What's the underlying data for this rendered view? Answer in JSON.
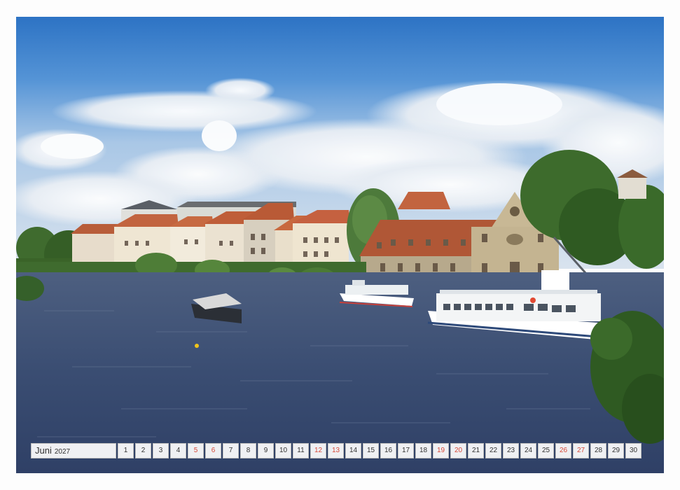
{
  "calendar": {
    "month": "Juni",
    "year": "2027",
    "days": [
      {
        "n": "1",
        "w": false
      },
      {
        "n": "2",
        "w": false
      },
      {
        "n": "3",
        "w": false
      },
      {
        "n": "4",
        "w": false
      },
      {
        "n": "5",
        "w": true
      },
      {
        "n": "6",
        "w": true
      },
      {
        "n": "7",
        "w": false
      },
      {
        "n": "8",
        "w": false
      },
      {
        "n": "9",
        "w": false
      },
      {
        "n": "10",
        "w": false
      },
      {
        "n": "11",
        "w": false
      },
      {
        "n": "12",
        "w": true
      },
      {
        "n": "13",
        "w": true
      },
      {
        "n": "14",
        "w": false
      },
      {
        "n": "15",
        "w": false
      },
      {
        "n": "16",
        "w": false
      },
      {
        "n": "17",
        "w": false
      },
      {
        "n": "18",
        "w": false
      },
      {
        "n": "19",
        "w": true
      },
      {
        "n": "20",
        "w": true
      },
      {
        "n": "21",
        "w": false
      },
      {
        "n": "22",
        "w": false
      },
      {
        "n": "23",
        "w": false
      },
      {
        "n": "24",
        "w": false
      },
      {
        "n": "25",
        "w": false
      },
      {
        "n": "26",
        "w": true
      },
      {
        "n": "27",
        "w": true
      },
      {
        "n": "28",
        "w": false
      },
      {
        "n": "29",
        "w": false
      },
      {
        "n": "30",
        "w": false
      }
    ]
  },
  "colors": {
    "weekend": "#d84a3a",
    "sky_top": "#2f78c8",
    "river": "#3b4f73"
  }
}
